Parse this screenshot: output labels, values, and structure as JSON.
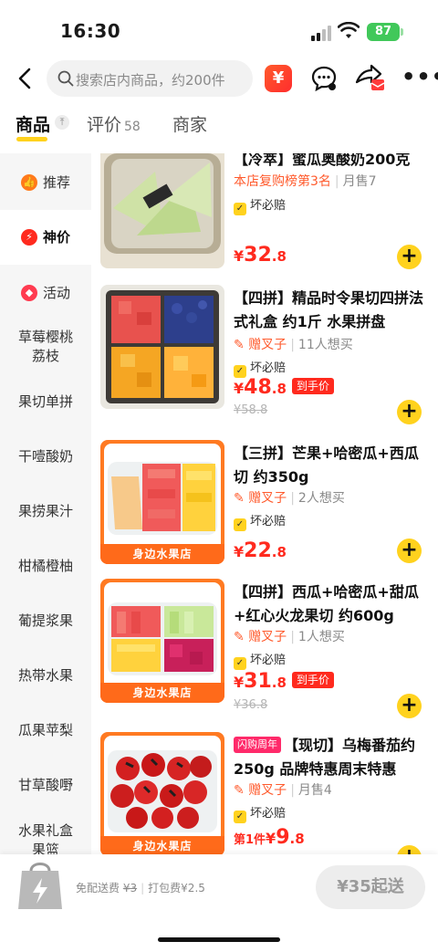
{
  "status_bar": {
    "time": "16:30",
    "battery": "87"
  },
  "nav": {
    "search_placeholder": "搜索店内商品，约200件",
    "coupon_glyph": "¥"
  },
  "tabs": {
    "goods": "商品",
    "reviews": "评价",
    "reviews_count": "58",
    "merchant": "商家"
  },
  "sidebar": {
    "items": [
      {
        "label": "推荐"
      },
      {
        "label": "神价"
      },
      {
        "label": "活动"
      },
      {
        "label": "草莓樱桃荔枝"
      },
      {
        "label": "果切单拼"
      },
      {
        "label": "干噎酸奶"
      },
      {
        "label": "果捞果汁"
      },
      {
        "label": "柑橘橙柚"
      },
      {
        "label": "葡提浆果"
      },
      {
        "label": "热带水果"
      },
      {
        "label": "瓜果苹梨"
      },
      {
        "label": "甘草酸嘢"
      },
      {
        "label": "水果礼盒果篮"
      }
    ]
  },
  "products": [
    {
      "title_partial": "【冷萃】蜜瓜奥酸奶200克",
      "rank": "本店复购榜第3名",
      "sales": "月售7",
      "guarantee": "坏必赔",
      "price_yen": "¥",
      "price_int": "32",
      "price_dec": ".8",
      "add": "+"
    },
    {
      "title": "【四拼】精品时令果切四拼法式礼盒 约1斤 水果拼盘",
      "gift": "赠叉子",
      "wants": "11人想买",
      "guarantee": "坏必赔",
      "price_yen": "¥",
      "price_int": "48",
      "price_dec": ".8",
      "hand_tag": "到手价",
      "orig_price": "¥58.8",
      "add": "+"
    },
    {
      "title": "【三拼】芒果+哈密瓜+西瓜切 约350g",
      "gift": "赠叉子",
      "wants": "2人想买",
      "guarantee": "坏必赔",
      "price_yen": "¥",
      "price_int": "22",
      "price_dec": ".8",
      "store_strip": "身边水果店",
      "add": "+"
    },
    {
      "title": "【四拼】西瓜+哈密瓜+甜瓜+红心火龙果切 约600g",
      "gift": "赠叉子",
      "wants": "1人想买",
      "guarantee": "坏必赔",
      "price_yen": "¥",
      "price_int": "31",
      "price_dec": ".8",
      "hand_tag": "到手价",
      "orig_price": "¥36.8",
      "store_strip": "身边水果店",
      "add": "+"
    },
    {
      "flash_tag": "闪购周年",
      "title": "【现切】乌梅番茄约250g 品牌特惠周末特惠",
      "gift": "赠叉子",
      "sales": "月售4",
      "guarantee": "坏必赔",
      "first_piece": "第1件",
      "price_yen": "¥",
      "price_int": "9",
      "price_dec": ".8",
      "store_strip": "身边水果店",
      "add": "+"
    }
  ],
  "bottom_bar": {
    "free_delivery": "免配送费",
    "delivery_fee": "¥3",
    "packing_fee": "打包费¥2.5",
    "min_order": "¥35起送"
  },
  "colors": {
    "accent_yellow": "#ffd21e",
    "price_red": "#ff2a1e",
    "gift_orange": "#ff5a2c",
    "store_orange": "#ff6a1a"
  }
}
